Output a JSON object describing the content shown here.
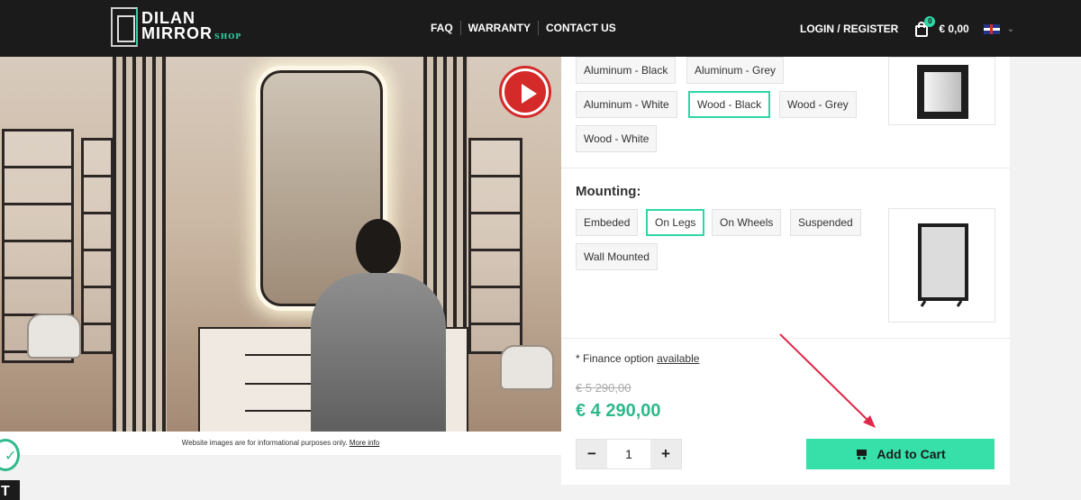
{
  "header": {
    "logo_line1": "DILAN",
    "logo_line2": "MIRROR",
    "logo_shop": "SHOP",
    "nav": [
      "FAQ",
      "WARRANTY",
      "CONTACT US"
    ],
    "login": "LOGIN / REGISTER",
    "cart_count": "0",
    "cart_total": "€ 0,00",
    "language": "en-flag",
    "colors": {
      "background": "#1b1b1b",
      "accent": "#2fd6a6"
    }
  },
  "hero": {
    "disclaimer": "Website images are for informational purposes only.",
    "more_info": "More info",
    "play_icon": "play-icon"
  },
  "frame_options": {
    "items": [
      "Aluminum - Black",
      "Aluminum - Grey",
      "Aluminum - White",
      "Wood - Black",
      "Wood - Grey",
      "Wood - White"
    ],
    "selected": "Wood - Black"
  },
  "mounting": {
    "title": "Mounting:",
    "items": [
      "Embeded",
      "On Legs",
      "On Wheels",
      "Suspended",
      "Wall Mounted"
    ],
    "selected": "On Legs"
  },
  "finance": {
    "text": "* Finance option",
    "link": "available"
  },
  "price": {
    "old": "€ 5 290,00",
    "new": "€ 4 290,00"
  },
  "quantity": {
    "minus": "−",
    "value": "1",
    "plus": "+"
  },
  "add_to_cart": "Add to Cart",
  "side_badge_letter": "T",
  "colors": {
    "price": "#2fb98a",
    "button": "#37e0a9",
    "selected_border": "#2fd6a6"
  }
}
